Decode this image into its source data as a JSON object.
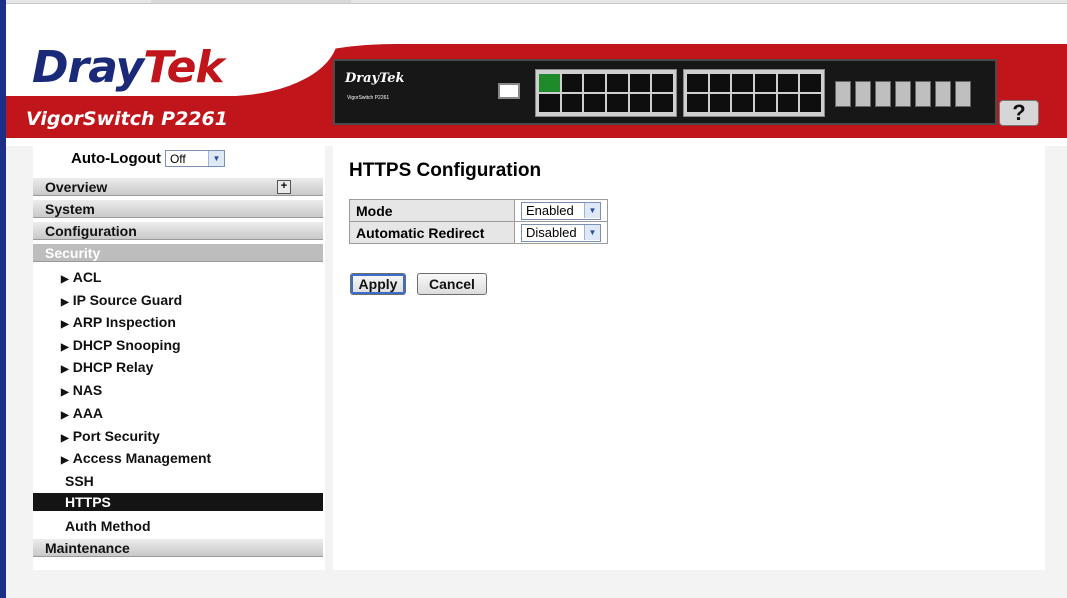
{
  "brand": {
    "logo_part1": "Dray",
    "logo_part2": "Tek",
    "model": "VigorSwitch P2261",
    "device_logo": "DrayTek",
    "device_caption": "VigorSwitch P2261"
  },
  "help": {
    "label": "?"
  },
  "auto_logout": {
    "label": "Auto-Logout",
    "value": "Off"
  },
  "nav": {
    "overview": "Overview",
    "system": "System",
    "configuration": "Configuration",
    "security": "Security",
    "security_items": [
      "ACL",
      "IP Source Guard",
      "ARP Inspection",
      "DHCP Snooping",
      "DHCP Relay",
      "NAS",
      "AAA",
      "Port Security",
      "Access Management"
    ],
    "ssh": "SSH",
    "https": "HTTPS",
    "auth_method": "Auth Method",
    "maintenance": "Maintenance"
  },
  "main": {
    "title": "HTTPS Configuration",
    "rows": [
      {
        "label": "Mode",
        "value": "Enabled"
      },
      {
        "label": "Automatic Redirect",
        "value": "Disabled"
      }
    ],
    "apply_label": "Apply",
    "cancel_label": "Cancel"
  },
  "colors": {
    "brand_red": "#c0151a",
    "brand_blue": "#1b2a78",
    "selected_nav": "#141414"
  }
}
